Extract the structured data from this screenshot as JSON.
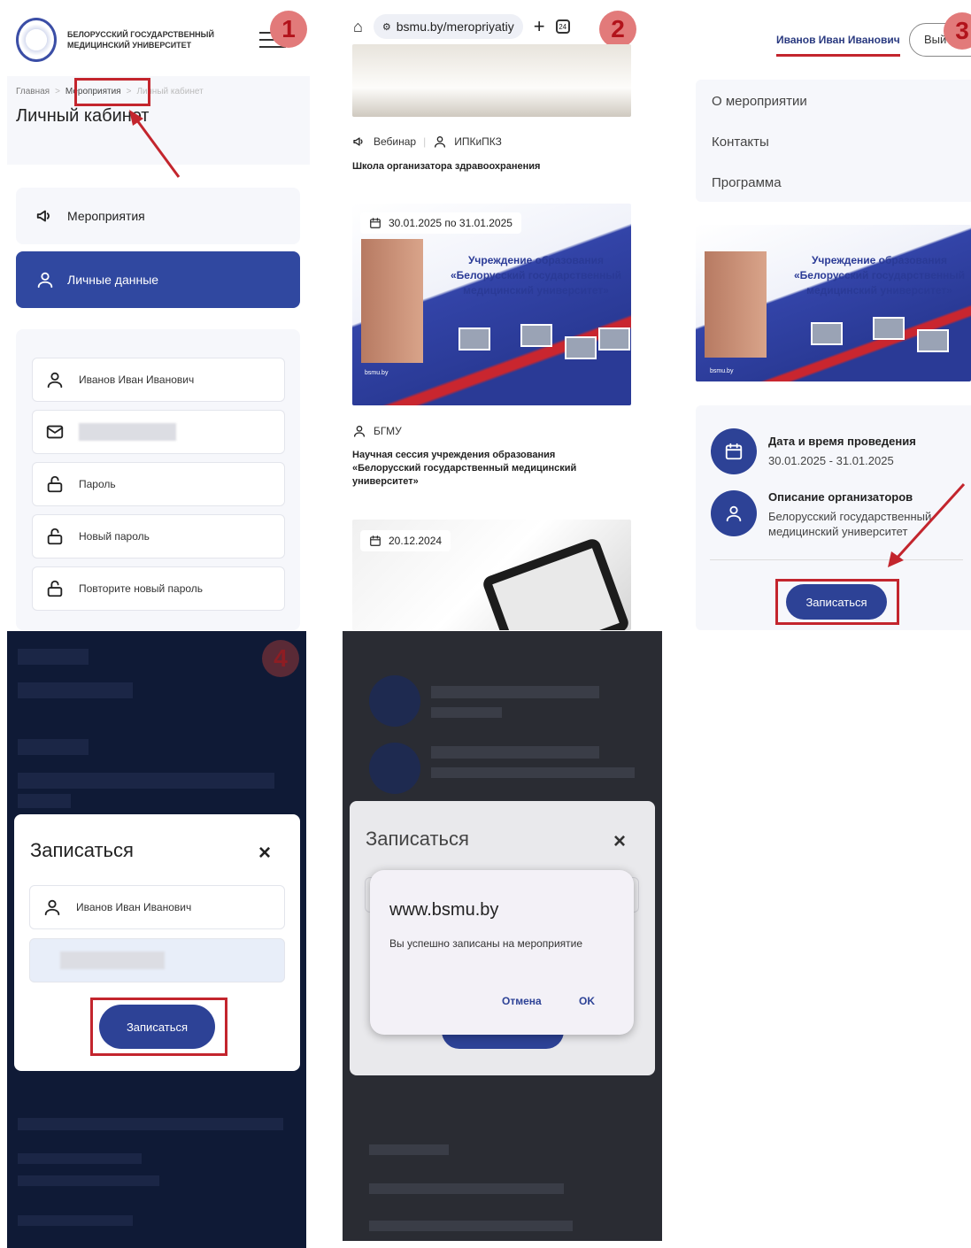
{
  "panel1": {
    "logo_line1": "БЕЛОРУССКИЙ ГОСУДАРСТВЕННЫЙ",
    "logo_line2": "МЕДИЦИНСКИЙ УНИВЕРСИТЕТ",
    "step": "1",
    "breadcrumbs": [
      "Главная",
      "Мероприятия",
      "Личный кабинет"
    ],
    "page_title": "Личный кабинет",
    "menu": [
      {
        "label": "Мероприятия",
        "icon": "megaphone-icon"
      },
      {
        "label": "Личные данные",
        "icon": "user-icon"
      }
    ],
    "fields": [
      {
        "label": "Иванов Иван Иванович",
        "icon": "user-icon"
      },
      {
        "label": "",
        "icon": "mail-icon"
      },
      {
        "label": "Пароль",
        "icon": "lock-icon"
      },
      {
        "label": "Новый пароль",
        "icon": "lock-icon"
      },
      {
        "label": "Повторите новый пароль",
        "icon": "lock-icon"
      }
    ]
  },
  "panel2": {
    "step": "2",
    "url": "bsmu.by/meropriyatiy",
    "tab_count": "24",
    "event1": {
      "type": "Вебинар",
      "organizer": "ИПКиПКЗ",
      "title": "Школа организатора здравоохранения"
    },
    "event2": {
      "date": "30.01.2025 по 31.01.2025",
      "banner_title": "Учреждение образования «Белорусский государственный медицинский университет»",
      "banner_caption": "bsmu.by",
      "organizer": "БГМУ",
      "title": "Научная сессия учреждения образования «Белорусский государственный медицинский университет»"
    },
    "event3": {
      "date": "20.12.2024"
    }
  },
  "panel3": {
    "step": "3",
    "user_name": "Иванов Иван Иванович",
    "logout_label": "Выйти",
    "side_menu": [
      "О мероприятии",
      "Контакты",
      "Программа"
    ],
    "banner_title": "Учреждение образования «Белорусский государственный медицинский университет»",
    "banner_caption": "bsmu.by",
    "date_label": "Дата и время проведения",
    "date_value": "30.01.2025 - 31.01.2025",
    "org_label": "Описание организаторов",
    "org_value": "Белорусский государственный медицинский университет",
    "register_label": "Записаться"
  },
  "panel4": {
    "step": "4",
    "modal_title": "Записаться",
    "close_icon": "×",
    "name_value": "Иванов Иван Иванович",
    "register_label": "Записаться"
  },
  "panel5": {
    "modal_title": "Записаться",
    "close_icon": "×",
    "dialog_title": "www.bsmu.by",
    "dialog_message": "Вы успешно записаны на мероприятие",
    "cancel_label": "Отмена",
    "ok_label": "OK"
  },
  "colors": {
    "primary": "#2d4296",
    "highlight": "#c3252d",
    "step_badge": "#e27a7a"
  }
}
